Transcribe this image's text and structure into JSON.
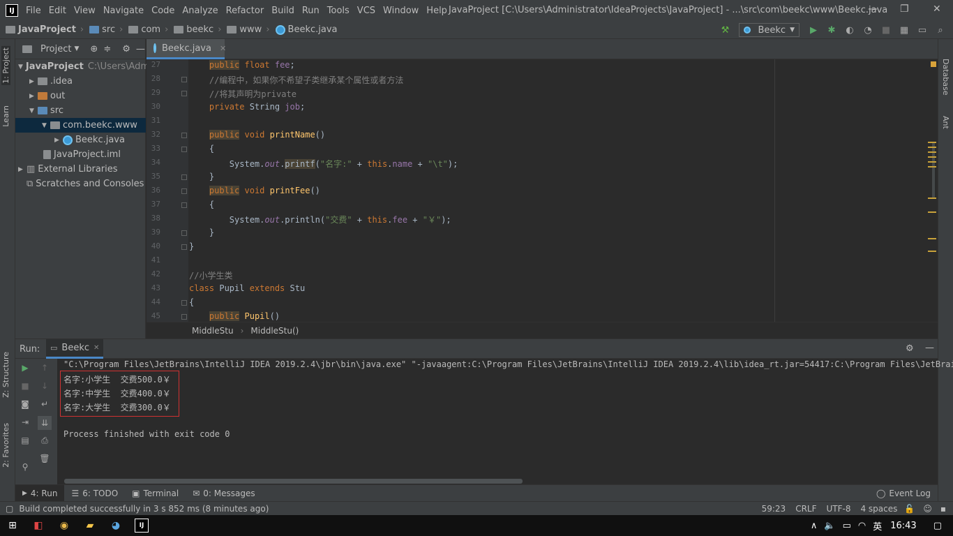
{
  "menubar": {
    "logo": "IJ",
    "items": [
      "File",
      "Edit",
      "View",
      "Navigate",
      "Code",
      "Analyze",
      "Refactor",
      "Build",
      "Run",
      "Tools",
      "VCS",
      "Window",
      "Help"
    ],
    "window_title": "JavaProject [C:\\Users\\Administrator\\IdeaProjects\\JavaProject] - ...\\src\\com\\beekc\\www\\Beekc.java"
  },
  "navbar": {
    "crumbs": [
      "JavaProject",
      "src",
      "com",
      "beekc",
      "www",
      "Beekc.java"
    ],
    "run_config": "Beekc"
  },
  "sidebar_left": {
    "tab_project": "1: Project",
    "tab_learn": "Learn",
    "tab_structure": "Z: Structure",
    "tab_favorites": "2: Favorites"
  },
  "sidebar_right": {
    "tab_database": "Database",
    "tab_ant": "Ant"
  },
  "project_panel": {
    "title": "Project",
    "tree": [
      {
        "label": "JavaProject",
        "hint": "C:\\Users\\Adm"
      },
      {
        "label": ".idea"
      },
      {
        "label": "out"
      },
      {
        "label": "src"
      },
      {
        "label": "com.beekc.www"
      },
      {
        "label": "Beekc.java"
      },
      {
        "label": "JavaProject.iml"
      },
      {
        "label": "External Libraries"
      },
      {
        "label": "Scratches and Consoles"
      }
    ]
  },
  "editor": {
    "tab_label": "Beekc.java",
    "line_numbers": [
      "27",
      "28",
      "29",
      "30",
      "31",
      "32",
      "33",
      "34",
      "35",
      "36",
      "37",
      "38",
      "39",
      "40",
      "41",
      "42",
      "43",
      "44",
      "45"
    ],
    "breadcrumb": [
      "MiddleStu",
      "MiddleStu()"
    ]
  },
  "run_panel": {
    "label": "Run:",
    "tab": "Beekc",
    "command": "\"C:\\Program Files\\JetBrains\\IntelliJ IDEA 2019.2.4\\jbr\\bin\\java.exe\" \"-javaagent:C:\\Program Files\\JetBrains\\IntelliJ IDEA 2019.2.4\\lib\\idea_rt.jar=54417:C:\\Program Files\\JetBrains",
    "output": [
      "名字:小学生  交费500.0￥",
      "名字:中学生  交费400.0￥",
      "名字:大学生  交费300.0￥"
    ],
    "finish": "Process finished with exit code 0"
  },
  "bottom_tabs": {
    "run": "4: Run",
    "todo": "6: TODO",
    "terminal": "Terminal",
    "messages": "0: Messages",
    "event_log": "Event Log"
  },
  "statusbar": {
    "message": "Build completed successfully in 3 s 852 ms (8 minutes ago)",
    "position": "59:23",
    "line_sep": "CRLF",
    "encoding": "UTF-8",
    "indent": "4 spaces"
  },
  "taskbar": {
    "ime": "英",
    "time": "16:43"
  },
  "colors": {
    "accent": "#4a88c7",
    "keyword": "#cc7832",
    "string": "#6a8759",
    "field": "#9876aa",
    "method": "#ffc66d",
    "comment": "#808080",
    "error_box": "#d03232"
  }
}
